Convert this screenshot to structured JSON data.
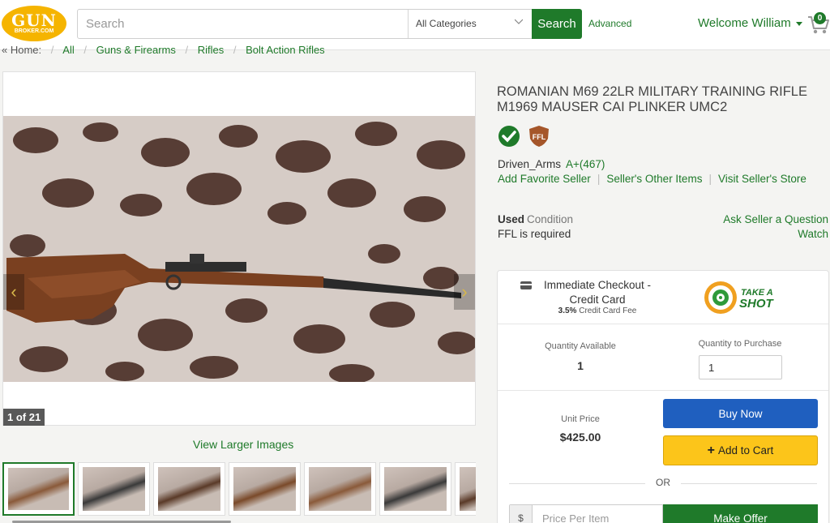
{
  "logo": {
    "line1": "GUN",
    "line2": "BROKER.COM"
  },
  "search": {
    "placeholder": "Search",
    "category": "All Categories",
    "button": "Search",
    "advanced": "Advanced"
  },
  "user": {
    "welcome": "Welcome William"
  },
  "cart": {
    "count": "0"
  },
  "breadcrumb": {
    "home": "« Home:",
    "items": [
      "All",
      "Guns & Firearms",
      "Rifles",
      "Bolt Action Rifles"
    ]
  },
  "gallery": {
    "counter": "1 of 21",
    "view_larger": "View Larger Images",
    "thumb_count": 7
  },
  "listing": {
    "title": "ROMANIAN M69 22LR MILITARY TRAINING RIFLE M1969 MAUSER CAI PLINKER UMC2",
    "ffl_badge": "FFL",
    "seller": "Driven_Arms",
    "rating": "A+(467)",
    "links": [
      "Add Favorite Seller",
      "Seller's Other Items",
      "Visit Seller's Store"
    ],
    "condition_value": "Used",
    "condition_label": "Condition",
    "ffl_required": "FFL is required",
    "ask_seller": "Ask Seller a Question",
    "watch": "Watch"
  },
  "buybox": {
    "checkout": "Immediate Checkout - Credit Card",
    "fee_rate": "3.5%",
    "fee_label": "Credit Card Fee",
    "take_shot_1": "TAKE A",
    "take_shot_2": "SHOT",
    "qty_available_label": "Quantity Available",
    "qty_available": "1",
    "qty_purchase_label": "Quantity to Purchase",
    "qty_purchase": "1",
    "unit_price_label": "Unit Price",
    "unit_price": "$425.00",
    "buy_now": "Buy Now",
    "add_to_cart": "Add to Cart",
    "or": "OR",
    "currency": "$",
    "price_placeholder": "Price Per Item",
    "make_offer": "Make Offer"
  },
  "colors": {
    "brand_green": "#1f7a2a",
    "buy_blue": "#1f5fbf",
    "cart_yellow": "#fcc51a",
    "logo_gold": "#f5b400"
  }
}
